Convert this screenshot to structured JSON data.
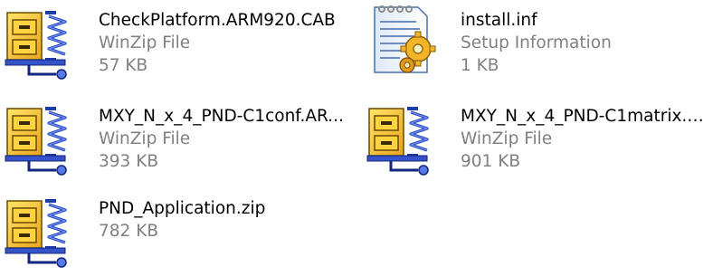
{
  "files": [
    {
      "name": "CheckPlatform.ARM920.CAB",
      "type": "WinZip File",
      "size": "57 KB",
      "icon": "winzip-file-icon"
    },
    {
      "name": "install.inf",
      "type": "Setup Information",
      "size": "1 KB",
      "icon": "setup-information-icon"
    },
    {
      "name": "MXY_N_x_4_PND-C1conf.AR...",
      "type": "WinZip File",
      "size": "393 KB",
      "icon": "winzip-file-icon"
    },
    {
      "name": "MXY_N_x_4_PND-C1matrix.A...",
      "type": "WinZip File",
      "size": "901 KB",
      "icon": "winzip-file-icon"
    },
    {
      "name": "PND_Application.zip",
      "size": "782 KB",
      "icon": "winzip-file-icon"
    }
  ],
  "colors": {
    "text": "#000000",
    "meta_text": "#808080",
    "background": "#ffffff"
  }
}
